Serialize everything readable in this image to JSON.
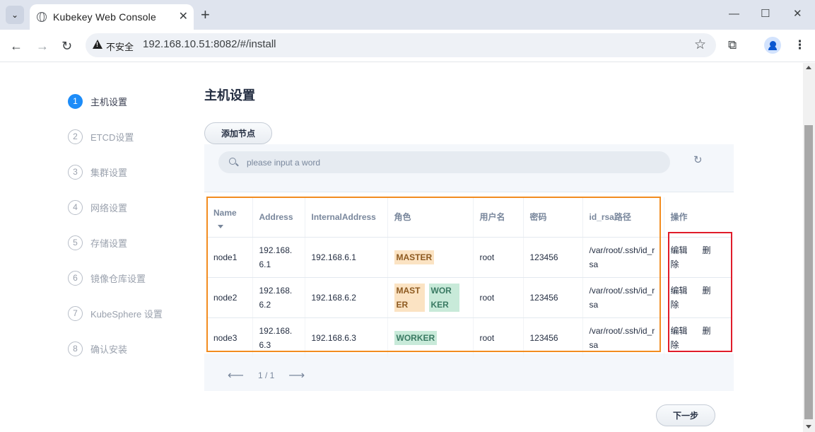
{
  "browser": {
    "tab_title": "Kubekey Web Console",
    "security_label": "不安全",
    "url": "192.168.10.51:8082/#/install"
  },
  "steps": [
    {
      "num": "1",
      "label": "主机设置",
      "active": true
    },
    {
      "num": "2",
      "label": "ETCD设置",
      "active": false
    },
    {
      "num": "3",
      "label": "集群设置",
      "active": false
    },
    {
      "num": "4",
      "label": "网络设置",
      "active": false
    },
    {
      "num": "5",
      "label": "存储设置",
      "active": false
    },
    {
      "num": "6",
      "label": "镜像仓库设置",
      "active": false
    },
    {
      "num": "7",
      "label": "KubeSphere 设置",
      "active": false
    },
    {
      "num": "8",
      "label": "确认安装",
      "active": false
    }
  ],
  "main": {
    "title": "主机设置",
    "add_node_label": "添加节点",
    "search_placeholder": "please input a word",
    "table": {
      "headers": [
        "Name",
        "Address",
        "InternalAddress",
        "角色",
        "用户名",
        "密码",
        "id_rsa路径",
        "操作"
      ],
      "rows": [
        {
          "name": "node1",
          "address": "192.168.6.1",
          "internal": "192.168.6.1",
          "roles": [
            "MASTER"
          ],
          "user": "root",
          "password": "123456",
          "id_rsa": "/var/root/.ssh/id_rsa",
          "edit": "编辑",
          "delete": "删除"
        },
        {
          "name": "node2",
          "address": "192.168.6.2",
          "internal": "192.168.6.2",
          "roles": [
            "MASTER",
            "WORKER"
          ],
          "user": "root",
          "password": "123456",
          "id_rsa": "/var/root/.ssh/id_rsa",
          "edit": "编辑",
          "delete": "删除"
        },
        {
          "name": "node3",
          "address": "192.168.6.3",
          "internal": "192.168.6.3",
          "roles": [
            "WORKER"
          ],
          "user": "root",
          "password": "123456",
          "id_rsa": "/var/root/.ssh/id_rsa",
          "edit": "编辑",
          "delete": "删除"
        }
      ]
    },
    "pagination": "1 / 1",
    "next_label": "下一步"
  },
  "colors": {
    "accent": "#1d8cf8",
    "master_tag_bg": "#fbe3c3",
    "worker_tag_bg": "#c8ead9",
    "highlight_orange": "#f28c1f",
    "highlight_red": "#e01c2a"
  }
}
